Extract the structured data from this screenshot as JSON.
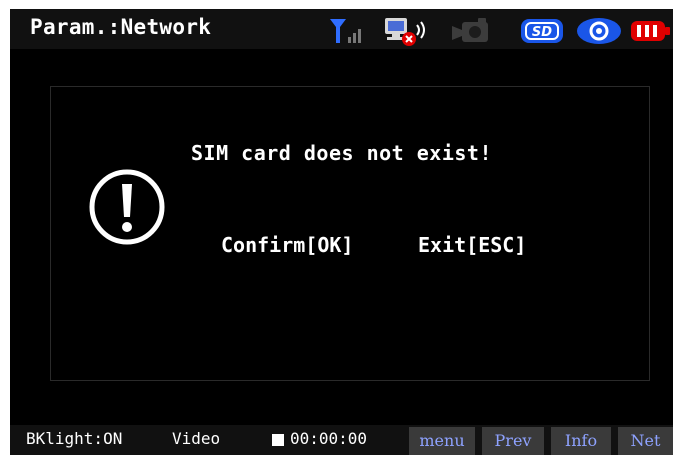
{
  "header": {
    "title": "Param.:Network",
    "icons": [
      "signal-icon",
      "network-disconnected-icon",
      "camera-icon",
      "sd-card-icon",
      "record-indicator-icon",
      "battery-icon"
    ]
  },
  "dialog": {
    "icon": "warning-icon",
    "message": "SIM card does not exist!",
    "confirm_label": "Confirm[OK]",
    "exit_label": "Exit[ESC]"
  },
  "footer": {
    "backlight": "BKlight:ON",
    "mode": "Video",
    "timer": "00:00:00",
    "softkeys": [
      "menu",
      "Prev",
      "Info",
      "Net"
    ]
  },
  "colors": {
    "background": "#000000",
    "bar": "#111111",
    "text": "#ffffff",
    "softkey_text": "#8ea2ff",
    "softkey_bg": "#3a3a3a",
    "accent_blue": "#1a56e8",
    "battery_red": "#e00000",
    "signal_blue": "#2f6dff"
  },
  "icon_labels": {
    "sd": "SD"
  }
}
